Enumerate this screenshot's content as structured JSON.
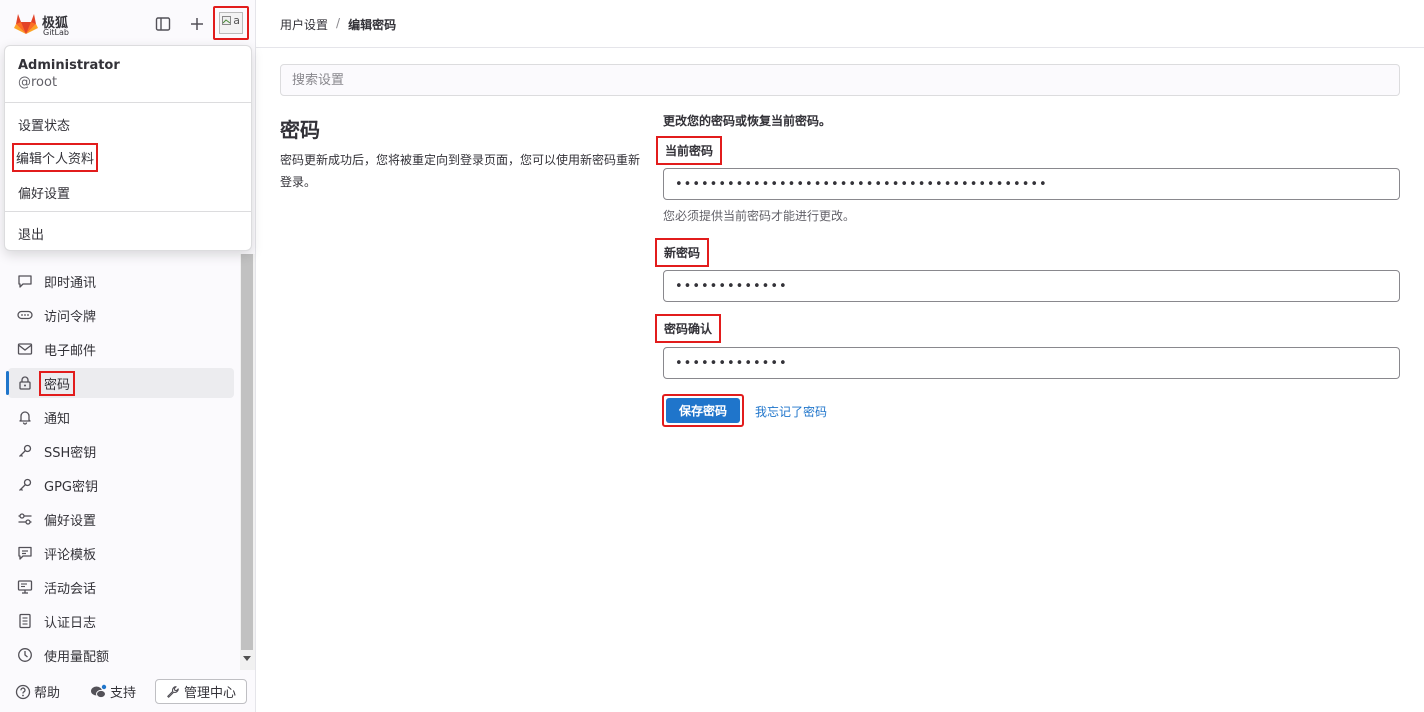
{
  "brand": {
    "name_cn": "极狐",
    "name_en": "GitLab",
    "accent": "#e24329"
  },
  "avatar": {
    "alt_text": "a"
  },
  "dropdown": {
    "name": "Administrator",
    "username": "@root",
    "items": [
      "设置状态",
      "编辑个人资料",
      "偏好设置"
    ],
    "signout": "退出"
  },
  "nav": {
    "items": [
      {
        "label": "即时通讯",
        "icon": "comment-icon"
      },
      {
        "label": "访问令牌",
        "icon": "token-icon"
      },
      {
        "label": "电子邮件",
        "icon": "mail-icon"
      },
      {
        "label": "密码",
        "icon": "lock-icon",
        "active": true
      },
      {
        "label": "通知",
        "icon": "bell-icon"
      },
      {
        "label": "SSH密钥",
        "icon": "key-icon"
      },
      {
        "label": "GPG密钥",
        "icon": "key-icon"
      },
      {
        "label": "偏好设置",
        "icon": "preferences-icon"
      },
      {
        "label": "评论模板",
        "icon": "comment-template-icon"
      },
      {
        "label": "活动会话",
        "icon": "monitor-icon"
      },
      {
        "label": "认证日志",
        "icon": "log-icon"
      },
      {
        "label": "使用量配额",
        "icon": "quota-icon"
      }
    ]
  },
  "footer": {
    "help": "帮助",
    "support": "支持",
    "admin": "管理中心"
  },
  "breadcrumb": {
    "parent": "用户设置",
    "current": "编辑密码"
  },
  "search": {
    "placeholder": "搜索设置"
  },
  "section": {
    "title": "密码",
    "description": "密码更新成功后，您将被重定向到登录页面，您可以使用新密码重新登录。"
  },
  "form": {
    "intro": "更改您的密码或恢复当前密码。",
    "current_label": "当前密码",
    "current_value": "•••••••••••••••••••••••••••••••••••••••••••",
    "current_help": "您必须提供当前密码才能进行更改。",
    "new_label": "新密码",
    "new_value": "•••••••••••••",
    "confirm_label": "密码确认",
    "confirm_value": "•••••••••••••",
    "save_label": "保存密码",
    "forgot_label": "我忘记了密码"
  },
  "colors": {
    "primary": "#1f75cb",
    "highlight": "#e21c1c"
  }
}
